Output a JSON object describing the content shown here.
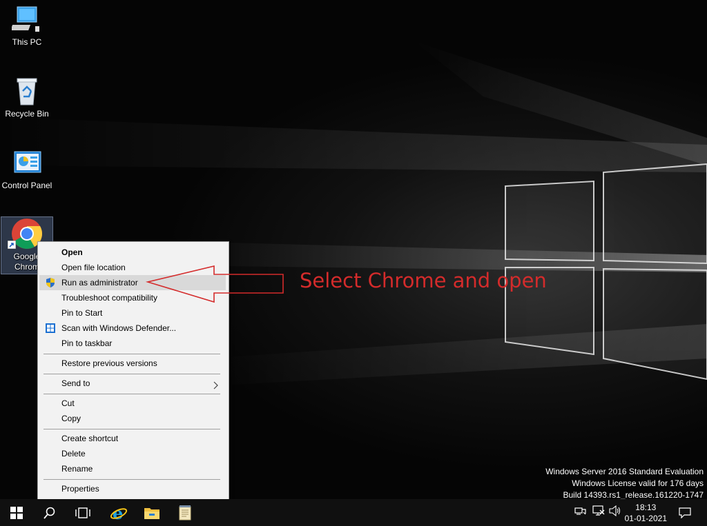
{
  "desktop": {
    "icons": [
      {
        "label": "This PC",
        "icon": "this-pc-icon"
      },
      {
        "label": "Recycle Bin",
        "icon": "recycle-bin-icon"
      },
      {
        "label": "Control Panel",
        "icon": "control-panel-icon"
      },
      {
        "label": "Google Chrome",
        "label_line1": "Google",
        "label_line2": "Chrom",
        "icon": "chrome-icon"
      }
    ]
  },
  "context_menu": {
    "items": [
      {
        "label": "Open",
        "bold": true
      },
      {
        "label": "Open file location"
      },
      {
        "label": "Run as administrator",
        "icon": "uac-shield-icon",
        "highlighted": true
      },
      {
        "label": "Troubleshoot compatibility"
      },
      {
        "label": "Pin to Start"
      },
      {
        "label": "Scan with Windows Defender...",
        "icon": "windows-defender-icon"
      },
      {
        "label": "Pin to taskbar"
      },
      {
        "label": "Restore previous versions"
      },
      {
        "label": "Send to",
        "submenu": true
      },
      {
        "label": "Cut"
      },
      {
        "label": "Copy"
      },
      {
        "label": "Create shortcut"
      },
      {
        "label": "Delete"
      },
      {
        "label": "Rename"
      },
      {
        "label": "Properties"
      }
    ]
  },
  "annotation": {
    "text": "Select Chrome and open",
    "color": "#d42b2b"
  },
  "watermark": {
    "line1": "Windows Server 2016 Standard Evaluation",
    "line2": "Windows License valid for 176 days",
    "line3": "Build 14393.rs1_release.161220-1747"
  },
  "taskbar": {
    "buttons": [
      "start-icon",
      "search-icon",
      "task-view-icon",
      "internet-explorer-icon",
      "file-explorer-icon",
      "notepad-icon"
    ],
    "tray_icons": [
      "network-icon",
      "display-icon",
      "volume-icon"
    ],
    "clock": {
      "time": "18:13",
      "date": "01-01-2021"
    },
    "notification_icon": "action-center-icon"
  }
}
